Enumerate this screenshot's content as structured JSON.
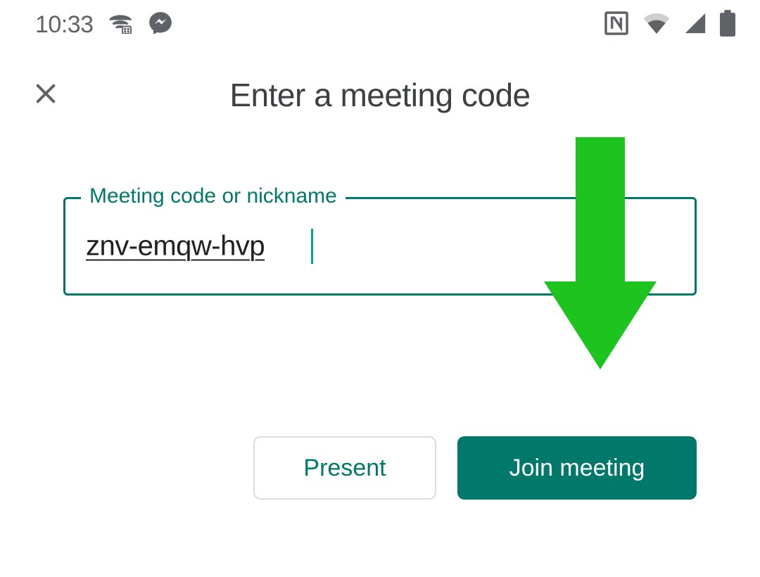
{
  "status": {
    "time": "10:33"
  },
  "header": {
    "title": "Enter a meeting code"
  },
  "input": {
    "label": "Meeting code or nickname",
    "value": "znv-emqw-hvp"
  },
  "buttons": {
    "present": "Present",
    "join": "Join meeting"
  },
  "colors": {
    "teal": "#00796b",
    "arrow": "#1ec41e"
  }
}
